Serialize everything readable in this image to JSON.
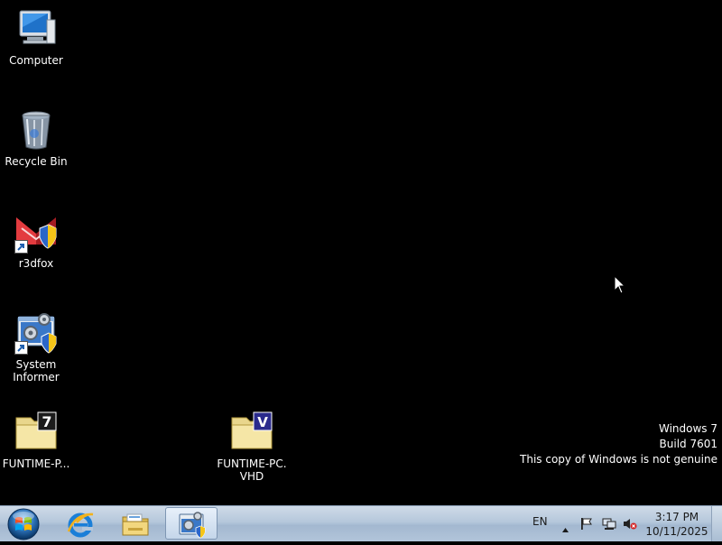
{
  "desktop": {
    "icons": [
      {
        "label": "Computer",
        "icon": "computer-icon"
      },
      {
        "label": "Recycle Bin",
        "icon": "recycle-bin-icon"
      },
      {
        "label": "r3dfox",
        "icon": "r3dfox-icon"
      },
      {
        "label": "System\nInformer",
        "icon": "system-informer-icon"
      },
      {
        "label": "FUNTIME-P...",
        "icon": "7z-archive-icon"
      },
      {
        "label": "FUNTIME-PC.\nVHD",
        "icon": "vhd-file-icon"
      }
    ],
    "watermark": {
      "line1": "Windows 7",
      "line2": "Build 7601",
      "line3": "This copy of Windows is not genuine"
    }
  },
  "taskbar": {
    "buttons": [
      {
        "name": "internet-explorer",
        "icon": "internet-explorer-icon"
      },
      {
        "name": "windows-explorer",
        "icon": "folder-library-icon"
      },
      {
        "name": "system-informer",
        "icon": "system-informer-icon",
        "active": true
      }
    ],
    "language": "EN",
    "clock": {
      "time": "3:17 PM",
      "date": "10/11/2025"
    },
    "tray_icons": [
      "show-hidden-icons-arrow",
      "action-center-flag-icon",
      "network-icon",
      "volume-muted-icon"
    ]
  },
  "colors": {
    "desktop_background": "#000000",
    "taskbar": "#b5c7db",
    "text": "#ffffff"
  }
}
